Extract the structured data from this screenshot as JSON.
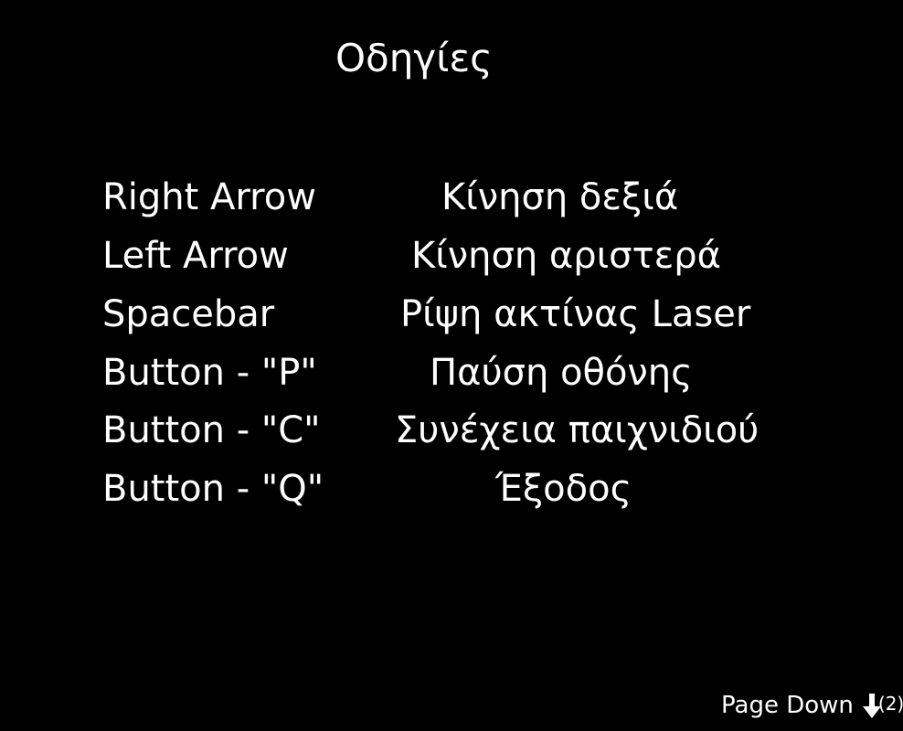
{
  "title": "Οδηγίες",
  "controls": [
    {
      "key": "Right Arrow",
      "action": "Κίνηση δεξιά"
    },
    {
      "key": "Left Arrow",
      "action": "Κίνηση αριστερά"
    },
    {
      "key": "Spacebar",
      "action": "Ρίψη ακτίνας Laser"
    },
    {
      "key": "Button - \"P\"",
      "action": "Παύση οθόνης"
    },
    {
      "key": "Button - \"C\"",
      "action": "Συνέχεια παιχνιδιού"
    },
    {
      "key": "Button - \"Q\"",
      "action": "Έξοδος"
    }
  ],
  "footer": {
    "label": "Page Down",
    "icon": "down-arrow-icon",
    "count": "(2)"
  },
  "colors": {
    "background": "#000000",
    "text": "#ffffff"
  }
}
